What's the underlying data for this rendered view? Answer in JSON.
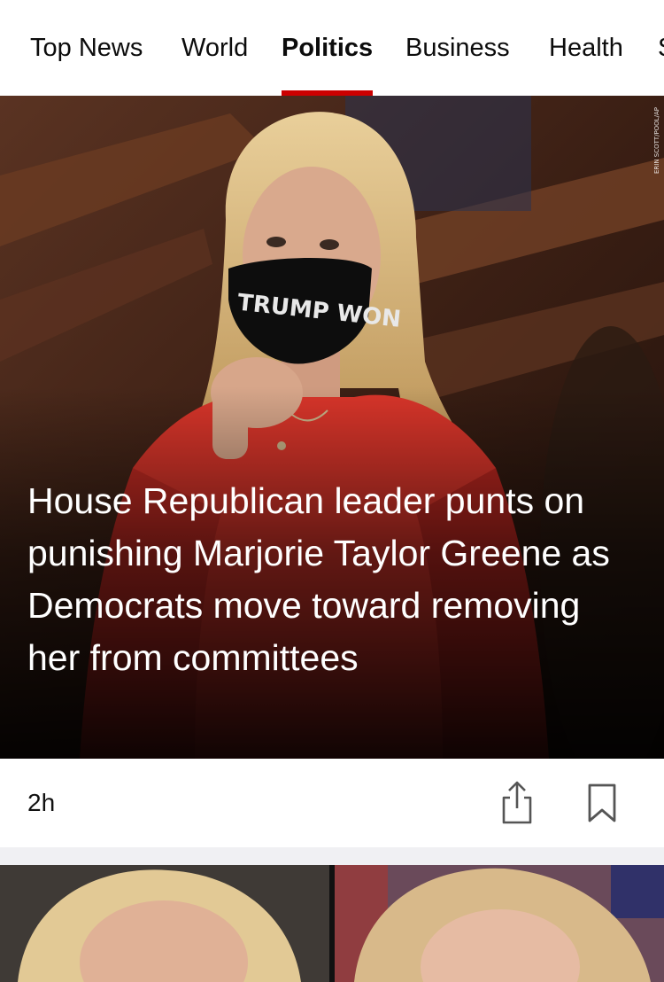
{
  "nav": {
    "tabs": [
      {
        "label": "Top News",
        "active": false
      },
      {
        "label": "World",
        "active": false
      },
      {
        "label": "Politics",
        "active": true
      },
      {
        "label": "Business",
        "active": false
      },
      {
        "label": "Health",
        "active": false
      },
      {
        "label": "S",
        "active": false
      }
    ],
    "accent_color": "#cc0000"
  },
  "hero": {
    "headline": "House Republican leader punts on punishing Marjorie Taylor Greene as Democrats move toward removing her from committees",
    "mask_text": "TRUMP WON",
    "photo_credit": "ERIN SCOTT/POOL/AP"
  },
  "story_meta": {
    "timestamp": "2h",
    "share_icon": "share-icon",
    "bookmark_icon": "bookmark-icon"
  }
}
